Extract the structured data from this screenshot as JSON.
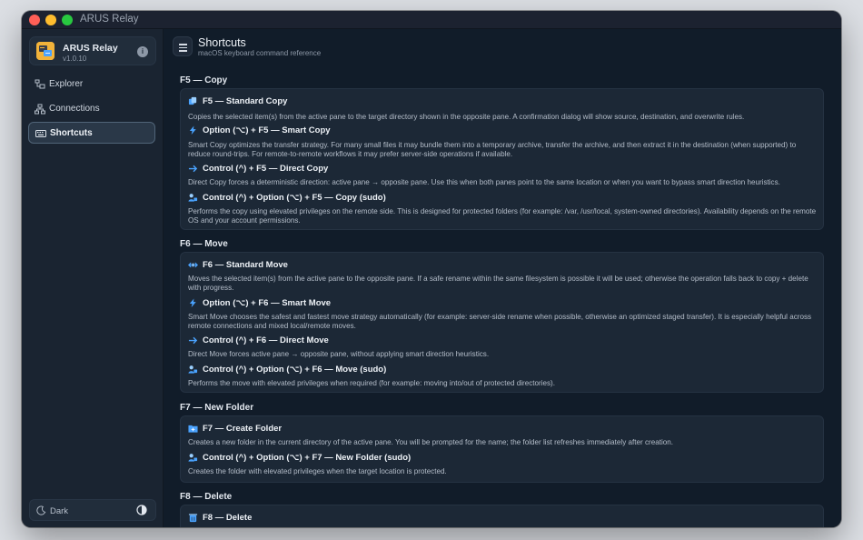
{
  "window": {
    "title": "ARUS Relay"
  },
  "colors": {
    "close": "#ff5f57",
    "minimize": "#febc2e",
    "maximize": "#28c840",
    "accent": "#4aa3ff",
    "sidebar_active_border": "#506478"
  },
  "sidebar": {
    "app_name": "ARUS Relay",
    "app_version": "v1.0.10",
    "info_icon": "info-icon",
    "items": [
      {
        "label": "Explorer",
        "icon": "explorer-icon",
        "active": false
      },
      {
        "label": "Connections",
        "icon": "connections-icon",
        "active": false
      },
      {
        "label": "Shortcuts",
        "icon": "keyboard-icon",
        "active": true
      }
    ],
    "theme_label": "Dark"
  },
  "header": {
    "title": "Shortcuts",
    "subtitle": "macOS keyboard command reference"
  },
  "sections": [
    {
      "title": "F5 — Copy",
      "items": [
        {
          "icon": "copy-icon",
          "heading": "F5 — Standard Copy",
          "desc": "Copies the selected item(s) from the active pane to the target directory shown in the opposite pane. A confirmation dialog will show source, destination, and overwrite rules."
        },
        {
          "icon": "bolt-icon",
          "heading": "Option (⌥) + F5 — Smart Copy",
          "desc": "Smart Copy optimizes the transfer strategy. For many small files it may bundle them into a temporary archive, transfer the archive, and then extract it in the destination (when supported) to reduce round-trips. For remote-to-remote workflows it may prefer server-side operations if available."
        },
        {
          "icon": "arrow-right-icon",
          "heading": "Control (^) + F5 — Direct Copy",
          "desc": "Direct Copy forces a deterministic direction: active pane → opposite pane. Use this when both panes point to the same location or when you want to bypass smart direction heuristics."
        },
        {
          "icon": "admin-user-icon",
          "heading": "Control (^) + Option (⌥) + F5 — Copy (sudo)",
          "desc": "Performs the copy using elevated privileges on the remote side. This is designed for protected folders (for example: /var, /usr/local, system-owned directories). Availability depends on the remote OS and your account permissions."
        }
      ]
    },
    {
      "title": "F6 — Move",
      "items": [
        {
          "icon": "move-icon",
          "heading": "F6 — Standard Move",
          "desc": "Moves the selected item(s) from the active pane to the opposite pane. If a safe rename within the same filesystem is possible it will be used; otherwise the operation falls back to copy + delete with progress."
        },
        {
          "icon": "bolt-icon",
          "heading": "Option (⌥) + F6 — Smart Move",
          "desc": "Smart Move chooses the safest and fastest move strategy automatically (for example: server-side rename when possible, otherwise an optimized staged transfer). It is especially helpful across remote connections and mixed local/remote moves."
        },
        {
          "icon": "arrow-right-icon",
          "heading": "Control (^) + F6 — Direct Move",
          "desc": "Direct Move forces active pane → opposite pane, without applying smart direction heuristics."
        },
        {
          "icon": "admin-user-icon",
          "heading": "Control (^) + Option (⌥) + F6 — Move (sudo)",
          "desc": "Performs the move with elevated privileges when required (for example: moving into/out of protected directories)."
        }
      ]
    },
    {
      "title": "F7 — New Folder",
      "items": [
        {
          "icon": "new-folder-icon",
          "heading": "F7 — Create Folder",
          "desc": "Creates a new folder in the current directory of the active pane. You will be prompted for the name; the folder list refreshes immediately after creation."
        },
        {
          "icon": "admin-user-icon",
          "heading": "Control (^) + Option (⌥) + F7 — New Folder (sudo)",
          "desc": "Creates the folder with elevated privileges when the target location is protected."
        }
      ]
    },
    {
      "title": "F8 — Delete",
      "items": [
        {
          "icon": "trash-icon",
          "heading": "F8 — Delete",
          "desc": ""
        }
      ]
    }
  ]
}
